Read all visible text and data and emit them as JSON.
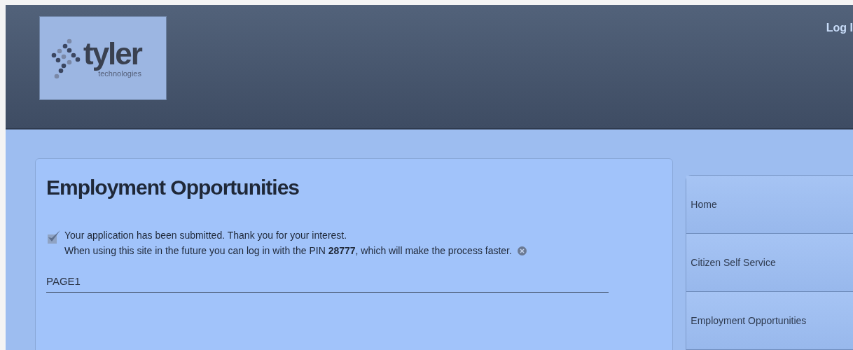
{
  "header": {
    "logo": {
      "name": "tyler",
      "tagline": "technologies"
    },
    "login_link": "Log I"
  },
  "main": {
    "title": "Employment Opportunities",
    "message": {
      "lines": [
        "Your application has been submitted. Thank you for your interest.",
        "When using this site in the future you can log in with the PIN **28777**, which will make the process faster."
      ]
    },
    "section": "PAGE1"
  },
  "sidebar": {
    "items": [
      {
        "label": "Home"
      },
      {
        "label": "Citizen Self Service"
      },
      {
        "label": "Employment Opportunities"
      }
    ]
  }
}
